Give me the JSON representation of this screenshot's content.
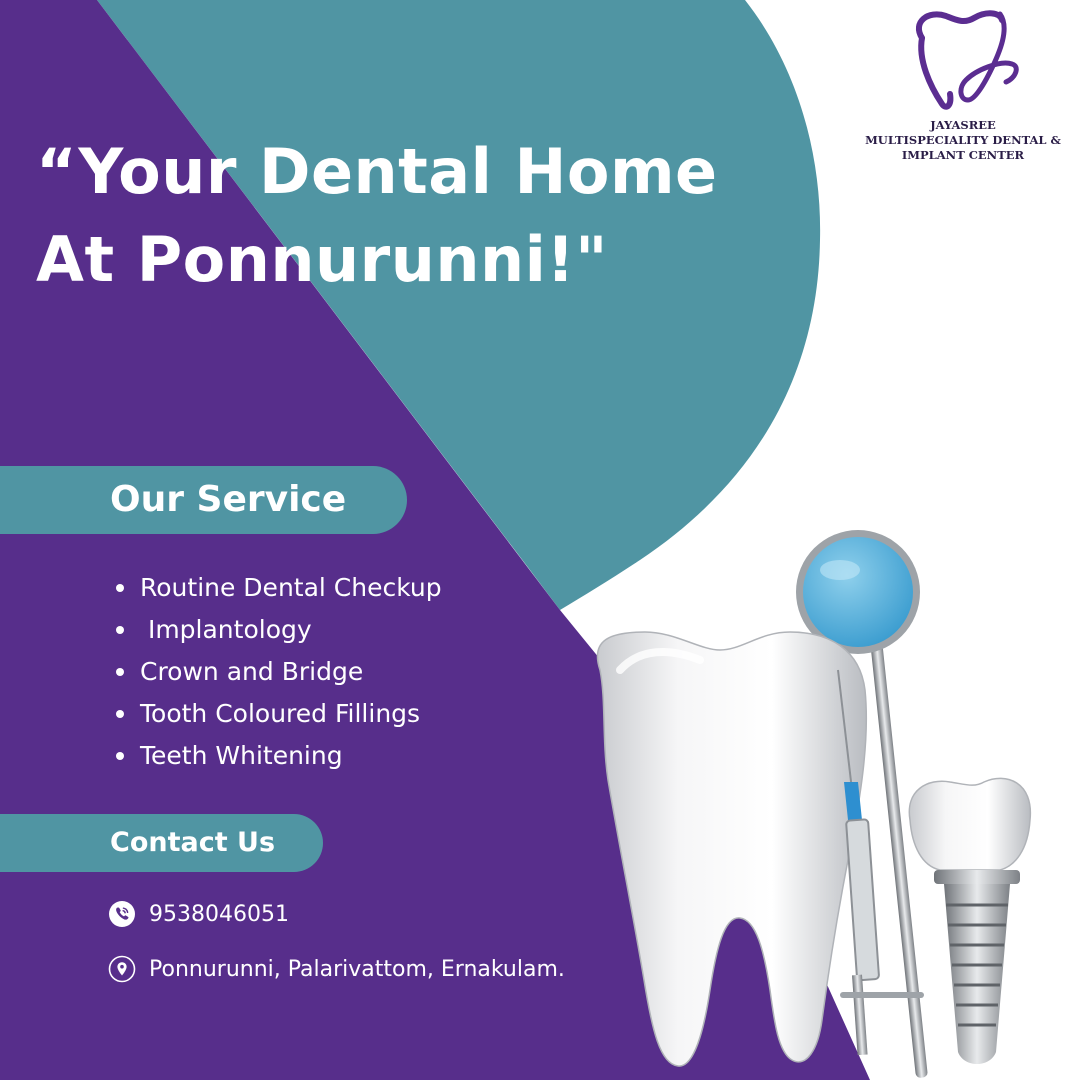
{
  "colors": {
    "purple": "#572e8b",
    "teal": "#5095a3",
    "white": "#ffffff",
    "logo_purple": "#5b2d91"
  },
  "headline": {
    "line1": "“Your Dental Home",
    "line2": "At Ponnurunni!\""
  },
  "brand": {
    "line1": "JAYASREE",
    "line2": "MULTISPECIALITY DENTAL &",
    "line3": "IMPLANT CENTER",
    "logo_icon": "tooth-logo-icon"
  },
  "services": {
    "title": "Our Service",
    "items": [
      {
        "label": "Routine Dental Checkup"
      },
      {
        "label": " Implantology"
      },
      {
        "label": "Crown and Bridge"
      },
      {
        "label": "Tooth Coloured Fillings"
      },
      {
        "label": "Teeth Whitening"
      }
    ]
  },
  "contact": {
    "title": "Contact Us",
    "phone": "9538046051",
    "phone_icon": "phone-icon",
    "address": "Ponnurunni, Palarivattom, Ernakulam.",
    "address_icon": "location-pin-icon"
  },
  "illustration": {
    "icons": [
      "tooth-icon",
      "dental-mirror-icon",
      "syringe-icon",
      "dental-implant-icon"
    ]
  }
}
